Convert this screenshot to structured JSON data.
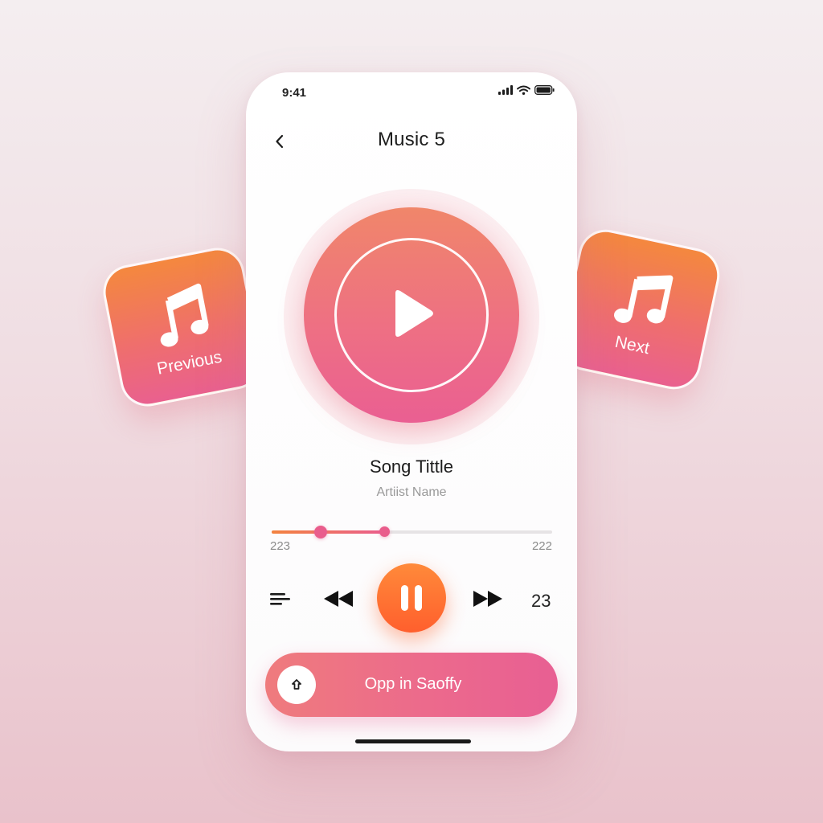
{
  "status_bar": {
    "time": "9:41",
    "icons": [
      "signal-icon",
      "wifi-icon",
      "battery-icon"
    ]
  },
  "header": {
    "back_icon": "chevron-left-icon",
    "title": "Music 5"
  },
  "player": {
    "play_icon": "play-icon",
    "song_title": "Song Tittle",
    "artist_name": "Artiist Name",
    "progress": {
      "fill_fraction": 0.4,
      "current_knob_fraction": 0.175,
      "time_left": "223",
      "time_right": "222"
    },
    "controls": {
      "menu_icon": "menu-lines-icon",
      "rewind_icon": "rewind-icon",
      "pause_icon": "pause-icon",
      "fast_forward_icon": "fast-forward-icon",
      "count": "23"
    },
    "open_button": {
      "icon": "app-icon",
      "label": "Opp in Saoffy"
    }
  },
  "cards": {
    "previous": {
      "icon": "music-note-icon",
      "label": "Previous"
    },
    "next": {
      "icon": "music-note-icon",
      "label": "Next"
    }
  },
  "colors": {
    "accent_orange": "#ff6a32",
    "accent_pink": "#e95d8c",
    "card_gradient_top": "#f4883e",
    "card_gradient_bottom": "#e9608f"
  }
}
